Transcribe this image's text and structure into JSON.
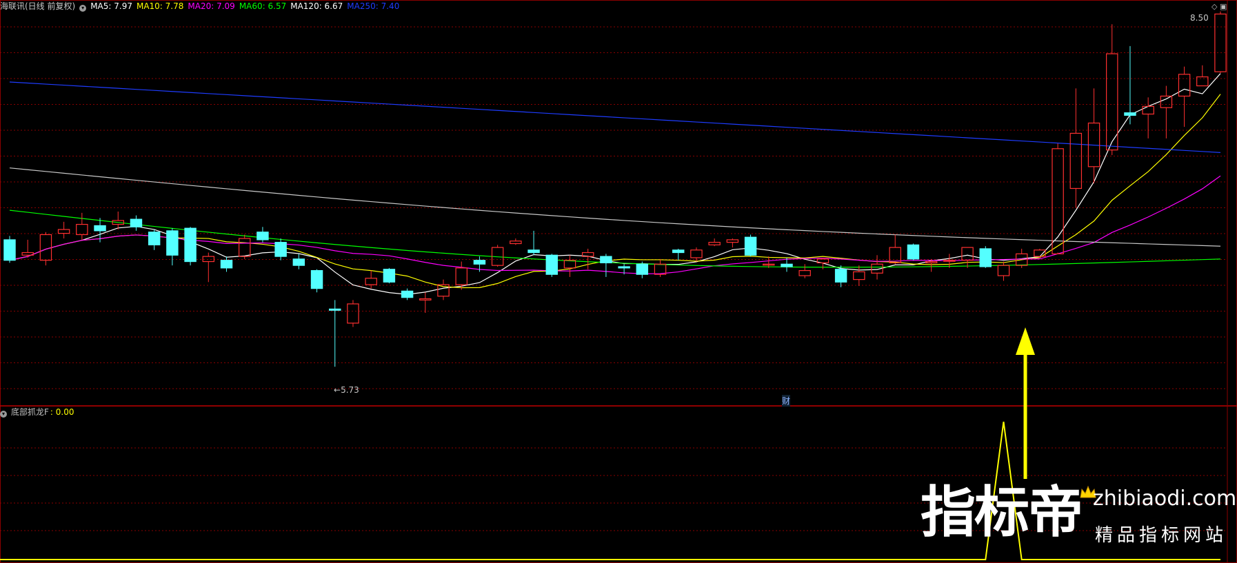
{
  "header": {
    "stock_label": "海联讯(日线 前复权)",
    "ma_items": [
      {
        "label": "MA5: 7.97",
        "color": "#ffffff"
      },
      {
        "label": "MA10: 7.78",
        "color": "#ffff00"
      },
      {
        "label": "MA20: 7.09",
        "color": "#ff00ff"
      },
      {
        "label": "MA60: 6.57",
        "color": "#00ff00"
      },
      {
        "label": "MA120: 6.67",
        "color": "#ffffff"
      },
      {
        "label": "MA250: 7.40",
        "color": "#1e3cff"
      }
    ]
  },
  "indicator": {
    "label": "底部抓龙F",
    "value": ": 0.00",
    "label_color": "#c0c0c0",
    "value_color": "#ffff00"
  },
  "annotations": {
    "low_label": "5.73",
    "high_label": "8.50",
    "finance_marker": "财"
  },
  "watermark": {
    "brand": "指标帝",
    "url": "zhibiaodi.com",
    "tagline": "精品指标网站"
  },
  "colors": {
    "background": "#000000",
    "up_candle": "#ff3030",
    "down_candle": "#54ffff",
    "grid": "#8b0000",
    "arrow": "#ffff00"
  },
  "chart_data": {
    "type": "candlestick",
    "ylim": [
      5.5,
      8.6
    ],
    "low_mark": 5.73,
    "high_mark": 8.5,
    "candles": [
      [
        6.72,
        6.56,
        6.75,
        6.54
      ],
      [
        6.6,
        6.62,
        6.72,
        6.58
      ],
      [
        6.56,
        6.76,
        6.78,
        6.52
      ],
      [
        6.77,
        6.8,
        6.86,
        6.73
      ],
      [
        6.76,
        6.84,
        6.93,
        6.72
      ],
      [
        6.83,
        6.79,
        6.89,
        6.7
      ],
      [
        6.84,
        6.87,
        6.94,
        6.8
      ],
      [
        6.88,
        6.82,
        6.91,
        6.79
      ],
      [
        6.78,
        6.68,
        6.8,
        6.64
      ],
      [
        6.79,
        6.6,
        6.81,
        6.52
      ],
      [
        6.81,
        6.55,
        6.82,
        6.52
      ],
      [
        6.55,
        6.59,
        6.62,
        6.39
      ],
      [
        6.56,
        6.5,
        6.59,
        6.47
      ],
      [
        6.59,
        6.73,
        6.76,
        6.57
      ],
      [
        6.78,
        6.72,
        6.82,
        6.7
      ],
      [
        6.7,
        6.59,
        6.73,
        6.56
      ],
      [
        6.57,
        6.52,
        6.61,
        6.49
      ],
      [
        6.48,
        6.34,
        6.49,
        6.31
      ],
      [
        6.18,
        6.17,
        6.25,
        5.73
      ],
      [
        6.07,
        6.22,
        6.25,
        6.04
      ],
      [
        6.37,
        6.42,
        6.48,
        6.34
      ],
      [
        6.49,
        6.39,
        6.5,
        6.38
      ],
      [
        6.32,
        6.27,
        6.34,
        6.25
      ],
      [
        6.25,
        6.26,
        6.31,
        6.15
      ],
      [
        6.28,
        6.37,
        6.41,
        6.25
      ],
      [
        6.37,
        6.5,
        6.55,
        6.33
      ],
      [
        6.56,
        6.53,
        6.59,
        6.47
      ],
      [
        6.52,
        6.66,
        6.68,
        6.51
      ],
      [
        6.69,
        6.71,
        6.73,
        6.68
      ],
      [
        6.64,
        6.62,
        6.79,
        6.6
      ],
      [
        6.6,
        6.45,
        6.61,
        6.43
      ],
      [
        6.5,
        6.56,
        6.6,
        6.43
      ],
      [
        6.59,
        6.62,
        6.65,
        6.49
      ],
      [
        6.59,
        6.54,
        6.61,
        6.43
      ],
      [
        6.51,
        6.5,
        6.53,
        6.45
      ],
      [
        6.53,
        6.45,
        6.55,
        6.42
      ],
      [
        6.45,
        6.53,
        6.57,
        6.43
      ],
      [
        6.64,
        6.62,
        6.65,
        6.56
      ],
      [
        6.58,
        6.64,
        6.66,
        6.55
      ],
      [
        6.68,
        6.7,
        6.73,
        6.67
      ],
      [
        6.7,
        6.72,
        6.73,
        6.66
      ],
      [
        6.74,
        6.6,
        6.76,
        6.59
      ],
      [
        6.53,
        6.53,
        6.59,
        6.5
      ],
      [
        6.53,
        6.51,
        6.58,
        6.47
      ],
      [
        6.44,
        6.48,
        6.53,
        6.42
      ],
      [
        6.54,
        6.57,
        6.58,
        6.49
      ],
      [
        6.49,
        6.39,
        6.52,
        6.35
      ],
      [
        6.41,
        6.47,
        6.52,
        6.36
      ],
      [
        6.46,
        6.53,
        6.6,
        6.41
      ],
      [
        6.54,
        6.66,
        6.76,
        6.53
      ],
      [
        6.68,
        6.57,
        6.69,
        6.56
      ],
      [
        6.54,
        6.55,
        6.57,
        6.47
      ],
      [
        6.56,
        6.56,
        6.61,
        6.5
      ],
      [
        6.56,
        6.66,
        6.66,
        6.5
      ],
      [
        6.65,
        6.51,
        6.67,
        6.5
      ],
      [
        6.44,
        6.52,
        6.55,
        6.4
      ],
      [
        6.52,
        6.61,
        6.65,
        6.5
      ],
      [
        6.59,
        6.64,
        6.65,
        6.58
      ],
      [
        6.61,
        7.43,
        7.47,
        6.62
      ],
      [
        7.12,
        7.55,
        7.9,
        6.97
      ],
      [
        7.29,
        7.63,
        7.9,
        7.16
      ],
      [
        7.42,
        8.17,
        8.4,
        7.38
      ],
      [
        7.71,
        7.69,
        8.23,
        7.62
      ],
      [
        7.7,
        7.76,
        7.83,
        7.51
      ],
      [
        7.75,
        7.84,
        7.92,
        7.51
      ],
      [
        7.84,
        8.01,
        8.07,
        7.6
      ],
      [
        7.92,
        7.99,
        8.08,
        7.92
      ],
      [
        8.03,
        8.48,
        8.5,
        8.02
      ]
    ],
    "indicator_values": [
      0,
      0,
      0,
      0,
      0,
      0,
      0,
      0,
      0,
      0,
      0,
      0,
      0,
      0,
      0,
      0,
      0,
      0,
      0,
      0,
      0,
      0,
      0,
      0,
      0,
      0,
      0,
      0,
      0,
      0,
      0,
      0,
      0,
      0,
      0,
      0,
      0,
      0,
      0,
      0,
      0,
      0,
      0,
      0,
      0,
      0,
      0,
      0,
      0,
      0,
      0,
      0,
      0,
      0,
      0,
      1,
      0,
      0,
      0,
      0,
      0,
      0,
      0,
      0,
      0,
      0,
      0,
      0
    ]
  }
}
